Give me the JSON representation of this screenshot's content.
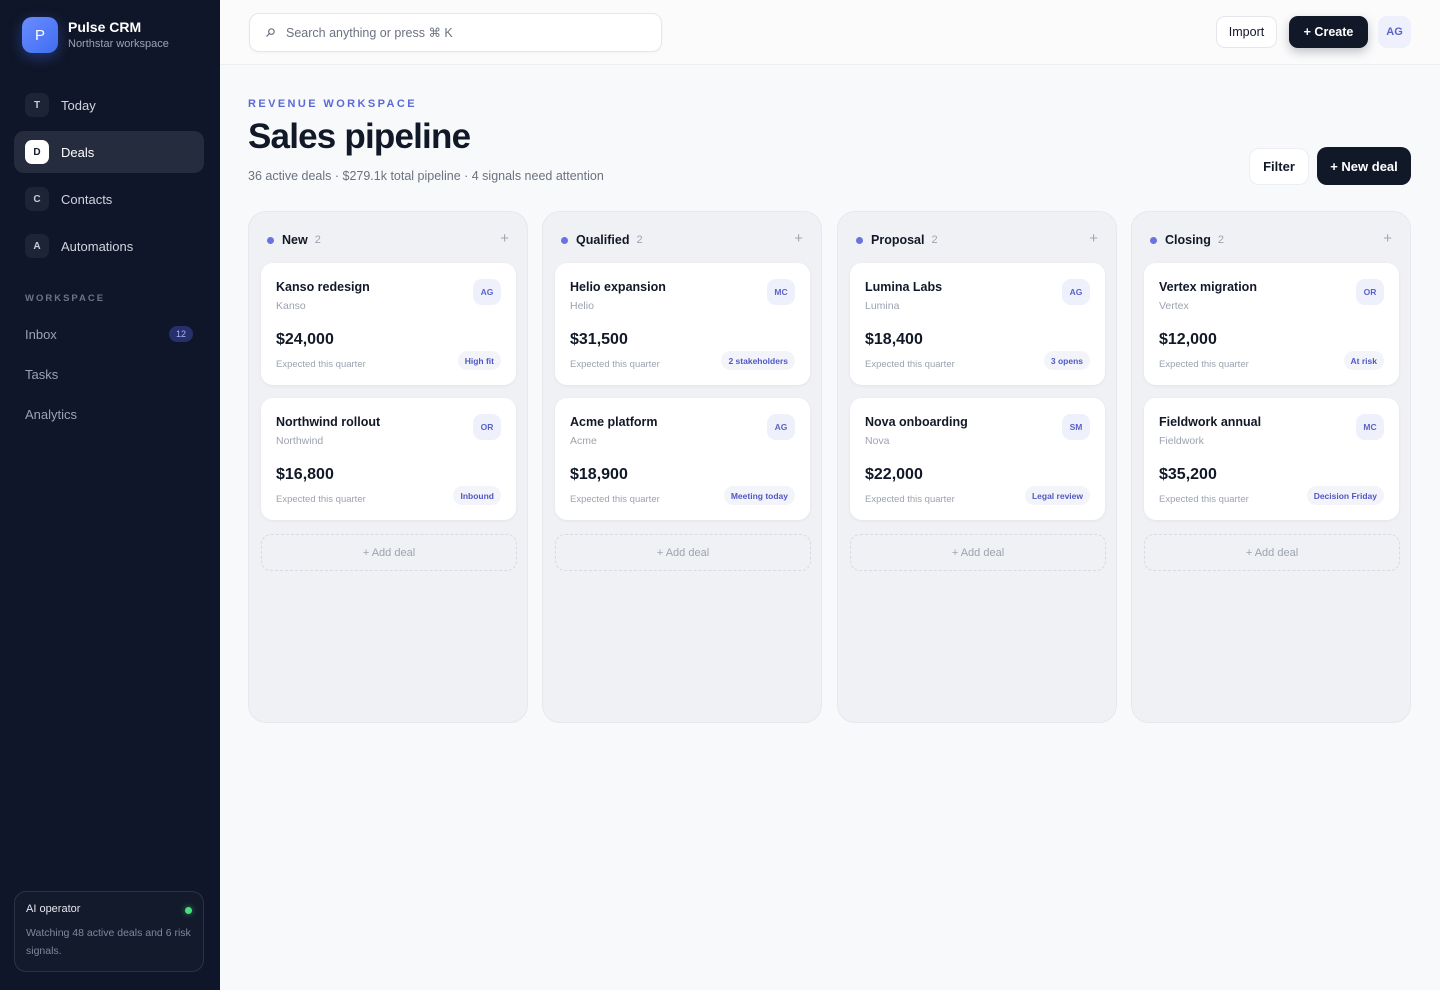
{
  "brand": {
    "initial": "P",
    "name": "Pulse CRM",
    "workspace": "Northstar workspace"
  },
  "nav": [
    {
      "key": "T",
      "label": "Today",
      "active": false
    },
    {
      "key": "D",
      "label": "Deals",
      "active": true
    },
    {
      "key": "C",
      "label": "Contacts",
      "active": false
    },
    {
      "key": "A",
      "label": "Automations",
      "active": false
    }
  ],
  "workspace_section": {
    "label": "WORKSPACE",
    "items": [
      {
        "label": "Inbox",
        "badge": "12"
      },
      {
        "label": "Tasks"
      },
      {
        "label": "Analytics"
      }
    ]
  },
  "ai_operator": {
    "title": "AI operator",
    "description": "Watching 48 active deals and 6 risk signals."
  },
  "topbar": {
    "search_placeholder": "Search anything or press ⌘ K",
    "import_label": "Import",
    "create_label": "+ Create",
    "user_initials": "AG"
  },
  "header": {
    "eyebrow": "REVENUE WORKSPACE",
    "title": "Sales pipeline",
    "subtitle": "36 active deals · $279.1k total pipeline · 4 signals need attention",
    "filter_label": "Filter",
    "new_deal_label": "+ New deal"
  },
  "board": {
    "add_deal_label": "+ Add deal",
    "columns": [
      {
        "name": "New",
        "count": "2",
        "cards": [
          {
            "title": "Kanso redesign",
            "company": "Kanso",
            "owner": "AG",
            "amount": "$24,000",
            "expected": "Expected this quarter",
            "tag": "High fit"
          },
          {
            "title": "Northwind rollout",
            "company": "Northwind",
            "owner": "OR",
            "amount": "$16,800",
            "expected": "Expected this quarter",
            "tag": "Inbound"
          }
        ]
      },
      {
        "name": "Qualified",
        "count": "2",
        "cards": [
          {
            "title": "Helio expansion",
            "company": "Helio",
            "owner": "MC",
            "amount": "$31,500",
            "expected": "Expected this quarter",
            "tag": "2 stakeholders"
          },
          {
            "title": "Acme platform",
            "company": "Acme",
            "owner": "AG",
            "amount": "$18,900",
            "expected": "Expected this quarter",
            "tag": "Meeting today"
          }
        ]
      },
      {
        "name": "Proposal",
        "count": "2",
        "cards": [
          {
            "title": "Lumina Labs",
            "company": "Lumina",
            "owner": "AG",
            "amount": "$18,400",
            "expected": "Expected this quarter",
            "tag": "3 opens"
          },
          {
            "title": "Nova onboarding",
            "company": "Nova",
            "owner": "SM",
            "amount": "$22,000",
            "expected": "Expected this quarter",
            "tag": "Legal review"
          }
        ]
      },
      {
        "name": "Closing",
        "count": "2",
        "cards": [
          {
            "title": "Vertex migration",
            "company": "Vertex",
            "owner": "OR",
            "amount": "$12,000",
            "expected": "Expected this quarter",
            "tag": "At risk"
          },
          {
            "title": "Fieldwork annual",
            "company": "Fieldwork",
            "owner": "MC",
            "amount": "$35,200",
            "expected": "Expected this quarter",
            "tag": "Decision Friday"
          }
        ]
      }
    ]
  },
  "colors": {
    "sidebar_bg": "#0f1629",
    "accent": "#5b6ad6",
    "primary_button": "#111827",
    "status_online": "#4ade80"
  }
}
